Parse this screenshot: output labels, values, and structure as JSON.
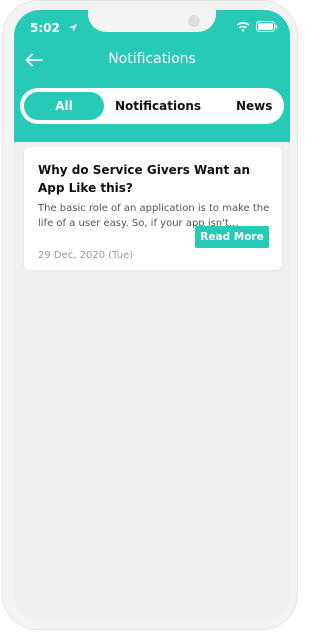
{
  "status_bar": {
    "time": "5:02"
  },
  "header": {
    "title": "Notifications"
  },
  "tabs": [
    {
      "label": "All",
      "active": true
    },
    {
      "label": "Notifications",
      "active": false
    },
    {
      "label": "News",
      "active": false
    }
  ],
  "card": {
    "title": "Why do Service Givers Want an App Like this?",
    "body": "The basic role of an application is to make the life of a user easy. So, if your app isn't…",
    "date": "29 Dec, 2020 (Tue)",
    "button_label": "Read More"
  },
  "colors": {
    "accent": "#26cab7",
    "background": "#f0f0f0"
  },
  "icons": [
    "back-arrow-icon",
    "location-arrow-icon",
    "wifi-icon",
    "battery-icon"
  ]
}
